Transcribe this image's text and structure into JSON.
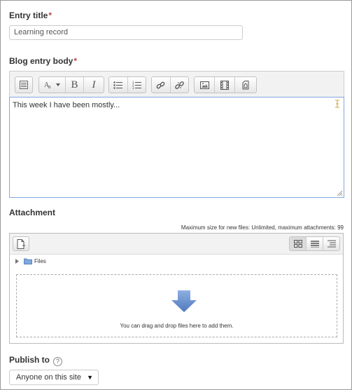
{
  "entry_title": {
    "label": "Entry title",
    "required_mark": "*",
    "value": "Learning record"
  },
  "body": {
    "label": "Blog entry body",
    "required_mark": "*",
    "content": "This week I have been mostly...",
    "toolbar": [
      {
        "icon": "toolbar-toggle-icon"
      },
      {
        "icon": "font-style-icon"
      },
      {
        "icon": "bold-icon",
        "glyph": "B"
      },
      {
        "icon": "italic-icon",
        "glyph": "I"
      },
      {
        "icon": "unordered-list-icon"
      },
      {
        "icon": "ordered-list-icon"
      },
      {
        "icon": "link-icon"
      },
      {
        "icon": "unlink-icon"
      },
      {
        "icon": "image-icon"
      },
      {
        "icon": "media-icon"
      },
      {
        "icon": "manage-files-icon"
      }
    ]
  },
  "attachment": {
    "label": "Attachment",
    "limits": "Maximum size for new files: Unlimited, maximum attachments: 99",
    "folder": "Files",
    "drop_text": "You can drag and drop files here to add them."
  },
  "publish": {
    "label": "Publish to",
    "help_glyph": "?",
    "selected": "Anyone on this site"
  },
  "colors": {
    "required": "#b94a48",
    "editor_border": "#80a8e0",
    "drop_arrow": "#5b83c4"
  }
}
